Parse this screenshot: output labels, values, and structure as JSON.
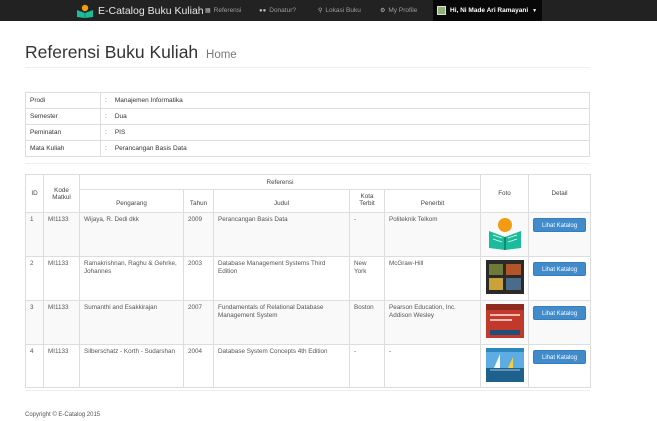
{
  "navbar": {
    "brand": "E-Catalog Buku Kuliah",
    "items": [
      {
        "label": "Referensi",
        "icon": "book-icon"
      },
      {
        "label": "Donatur?",
        "icon": "users-icon"
      },
      {
        "label": "Lokasi Buku",
        "icon": "map-marker-icon"
      },
      {
        "label": "My Profile",
        "icon": "gear-icon"
      }
    ],
    "user": "Hi, Ni Made Ari Ramayani"
  },
  "header": {
    "title": "Referensi Buku Kuliah",
    "subtitle": "Home"
  },
  "info": {
    "separator": ":",
    "rows": [
      {
        "label": "Prodi",
        "value": "Manajemen Informatika"
      },
      {
        "label": "Semester",
        "value": "Dua"
      },
      {
        "label": "Peminatan",
        "value": "PIS"
      },
      {
        "label": "Mata Kuliah",
        "value": "Perancangan Basis Data"
      }
    ]
  },
  "table": {
    "group_header": "Referensi",
    "headers": {
      "id": "ID",
      "kode": "Kode Matkul",
      "pengarang": "Pengarang",
      "tahun": "Tahun",
      "judul": "Judul",
      "kota": "Kota Terbit",
      "penerbit": "Penerbit",
      "foto": "Foto",
      "detail": "Detail"
    },
    "button_label": "Lihat Katalog",
    "rows": [
      {
        "id": "1",
        "kode": "MI1133",
        "pengarang": "Wijaya, R. Dedi dkk",
        "tahun": "2009",
        "judul": "Perancangan Basis Data",
        "kota": "-",
        "penerbit": "Politeknik Telkom"
      },
      {
        "id": "2",
        "kode": "MI1133",
        "pengarang": "Ramakrishnan, Raghu & Gehrke, Johannes",
        "tahun": "2003",
        "judul": "Database Management Systems Third Edition",
        "kota": "New York",
        "penerbit": "McGraw-Hill"
      },
      {
        "id": "3",
        "kode": "MI1133",
        "pengarang": "Sumanthi and Esakkirajan",
        "tahun": "2007",
        "judul": "Fundamentals of Relational Database Management System",
        "kota": "Boston",
        "penerbit": "Pearson Education, Inc. Addison Wesley"
      },
      {
        "id": "4",
        "kode": "MI1133",
        "pengarang": "Silberschatz - Korth - Sudarshan",
        "tahun": "2004",
        "judul": "Database System Concepts 4th Edition",
        "kota": "-",
        "penerbit": "-"
      }
    ]
  },
  "footer": {
    "copyright": "Copyright © E-Catalog 2015"
  },
  "colors": {
    "navbar": "#222222",
    "button": "#428bca",
    "border": "#dddddd"
  }
}
